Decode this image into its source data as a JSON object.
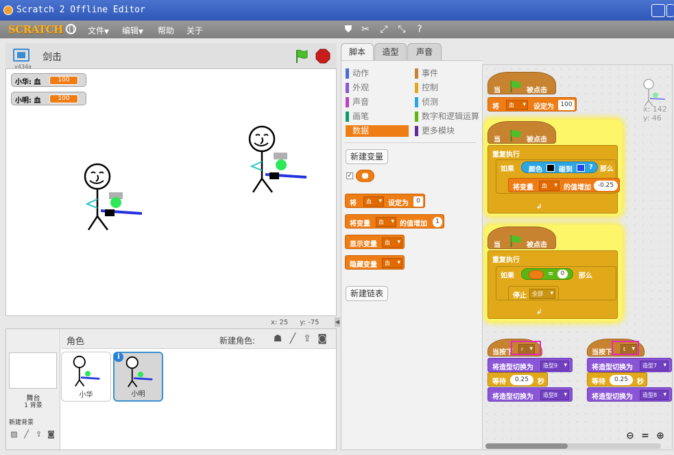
{
  "window": {
    "title": "Scratch 2 Offline Editor"
  },
  "menu": {
    "logo": "SCRATCH",
    "items": [
      "文件",
      "编辑",
      "帮助",
      "关于"
    ],
    "tools": [
      "duplicate-tool",
      "delete-tool",
      "grow-tool",
      "shrink-tool",
      "help-tool"
    ]
  },
  "stage": {
    "version": "v434a",
    "project_title": "剑击",
    "monitors": [
      {
        "label": "小华: 血",
        "value": "100"
      },
      {
        "label": "小明: 血",
        "value": "100"
      }
    ],
    "coords": {
      "x": "x: 25",
      "y": "y: -75"
    }
  },
  "sprite_pane": {
    "stage_label": "舞台",
    "backdrop_count": "1 背景",
    "new_backdrop": "新建背景",
    "sprites_title": "角色",
    "new_sprite": "新建角色:",
    "sprites": [
      {
        "name": "小华",
        "selected": false
      },
      {
        "name": "小明",
        "selected": true
      }
    ]
  },
  "tabs": [
    "脚本",
    "造型",
    "声音"
  ],
  "palette": {
    "categories_left": [
      {
        "label": "动作",
        "color": "#4a6cd4"
      },
      {
        "label": "外观",
        "color": "#8a55d7"
      },
      {
        "label": "声音",
        "color": "#bb42c3"
      },
      {
        "label": "画笔",
        "color": "#0e9a6c"
      },
      {
        "label": "数据",
        "color": "#ee7d16"
      }
    ],
    "categories_right": [
      {
        "label": "事件",
        "color": "#c88330"
      },
      {
        "label": "控制",
        "color": "#e1a91a"
      },
      {
        "label": "侦测",
        "color": "#2ca5e2"
      },
      {
        "label": "数字和逻辑运算",
        "color": "#5cb712"
      },
      {
        "label": "更多模块",
        "color": "#632d99"
      }
    ],
    "active_category": "数据",
    "new_variable": "新建变量",
    "new_list": "新建链表",
    "blocks": {
      "set_pre": "将",
      "set_var": "血",
      "set_mid": "设定为",
      "set_val": "0",
      "change_pre": "将变量",
      "change_var": "血",
      "change_mid": "的值增加",
      "change_val": "1",
      "show_pre": "显示变量",
      "show_var": "血",
      "hide_pre": "隐藏变量",
      "hide_var": "血"
    }
  },
  "scripts": {
    "sprite_x": "x: 142",
    "sprite_y": "y: 46",
    "when_flag": "当",
    "clicked": "被点击",
    "set_pre": "将",
    "set_var": "血",
    "set_mid": "设定为",
    "set_val": "100",
    "forever": "重复执行",
    "if": "如果",
    "then": "那么",
    "color": "颜色",
    "touching": "碰到",
    "question": "?",
    "change_pre": "将变量",
    "change_var": "血",
    "change_mid": "的值增加",
    "change_val": "-0.25",
    "eq_val": "0",
    "eq": "=",
    "stop": "停止",
    "stop_opt": "全部",
    "key_a": "r",
    "key_b": "t",
    "when_key": "当按下",
    "switch_costume": "将造型切换为",
    "costume9": "造型9",
    "costume7": "造型7",
    "costume8": "造型8",
    "wait": "等待",
    "wait_val": "0.25",
    "sec": "秒"
  }
}
